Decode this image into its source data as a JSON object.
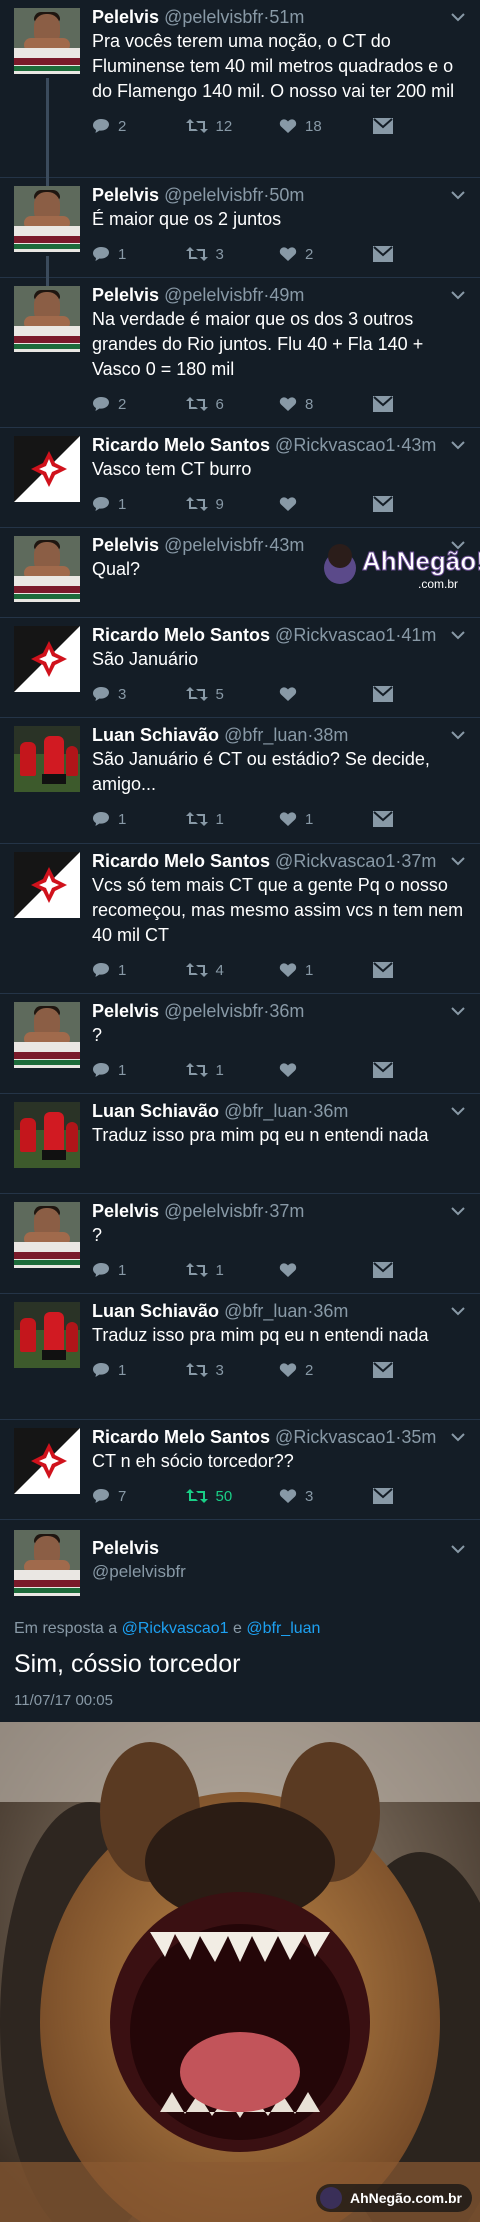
{
  "tweets": [
    {
      "name": "Pelelvis",
      "handle": "@pelelvisbfr",
      "time": "51m",
      "text": "Pra vocês terem uma noção, o CT do Fluminense tem 40 mil metros quadrados e o do Flamengo 140 mil. O nosso vai ter 200 mil",
      "replies": "2",
      "retweets": "12",
      "likes": "18"
    },
    {
      "name": "Pelelvis",
      "handle": "@pelelvisbfr",
      "time": "50m",
      "text": "É maior que os 2 juntos",
      "replies": "1",
      "retweets": "3",
      "likes": "2"
    },
    {
      "name": "Pelelvis",
      "handle": "@pelelvisbfr",
      "time": "49m",
      "text": "Na verdade é maior que os dos 3 outros grandes do Rio juntos. Flu 40 + Fla 140 + Vasco 0 = 180 mil",
      "replies": "2",
      "retweets": "6",
      "likes": "8"
    },
    {
      "name": "Ricardo Melo Santos",
      "handle": "@Rickvascao1",
      "time": "43m",
      "text": "Vasco tem CT burro",
      "replies": "1",
      "retweets": "9",
      "likes": ""
    },
    {
      "name": "Pelelvis",
      "handle": "@pelelvisbfr",
      "time": "43m",
      "text": "Qual?",
      "replies": "",
      "retweets": "",
      "likes": ""
    },
    {
      "name": "Ricardo Melo Santos",
      "handle": "@Rickvascao1",
      "time": "41m",
      "text": "São Januário",
      "replies": "3",
      "retweets": "5",
      "likes": ""
    },
    {
      "name": "Luan Schiavão",
      "handle": "@bfr_luan",
      "time": "38m",
      "text": "São Januário é CT ou estádio? Se decide, amigo...",
      "replies": "1",
      "retweets": "1",
      "likes": "1"
    },
    {
      "name": "Ricardo Melo Santos",
      "handle": "@Rickvascao1",
      "time": "37m",
      "text": "Vcs só tem mais CT que a gente Pq o nosso recomeçou, mas mesmo assim vcs n tem nem 40 mil CT",
      "replies": "1",
      "retweets": "4",
      "likes": "1"
    },
    {
      "name": "Pelelvis",
      "handle": "@pelelvisbfr",
      "time": "36m",
      "text": "?",
      "replies": "1",
      "retweets": "1",
      "likes": ""
    },
    {
      "name": "Luan Schiavão",
      "handle": "@bfr_luan",
      "time": "36m",
      "text": "Traduz isso pra mim pq eu n entendi nada",
      "replies": "",
      "retweets": "",
      "likes": ""
    },
    {
      "name": "Pelelvis",
      "handle": "@pelelvisbfr",
      "time": "37m",
      "text": "?",
      "replies": "1",
      "retweets": "1",
      "likes": ""
    },
    {
      "name": "Luan Schiavão",
      "handle": "@bfr_luan",
      "time": "36m",
      "text": "Traduz isso pra mim pq eu n entendi nada",
      "replies": "1",
      "retweets": "3",
      "likes": "2"
    },
    {
      "name": "Ricardo Melo Santos",
      "handle": "@Rickvascao1",
      "time": "35m",
      "text": "CT n eh sócio torcedor??",
      "replies": "7",
      "retweets": "50",
      "likes": "3"
    }
  ],
  "main_tweet": {
    "name": "Pelelvis",
    "handle": "@pelelvisbfr",
    "reply_prefix": "Em resposta a",
    "reply_user1": "@Rickvascao1",
    "reply_and": "e",
    "reply_user2": "@bfr_luan",
    "text": "Sim, cóssio torcedor",
    "timestamp": "11/07/17 00:05"
  },
  "watermark": {
    "top_brand": "AhNegão!",
    "top_domain": ".com.br",
    "bottom": "AhNegão.com.br"
  },
  "colors": {
    "background": "#141d26",
    "muted": "#8899a6",
    "link": "#1da1f2",
    "retweet_active": "#19cf86"
  }
}
